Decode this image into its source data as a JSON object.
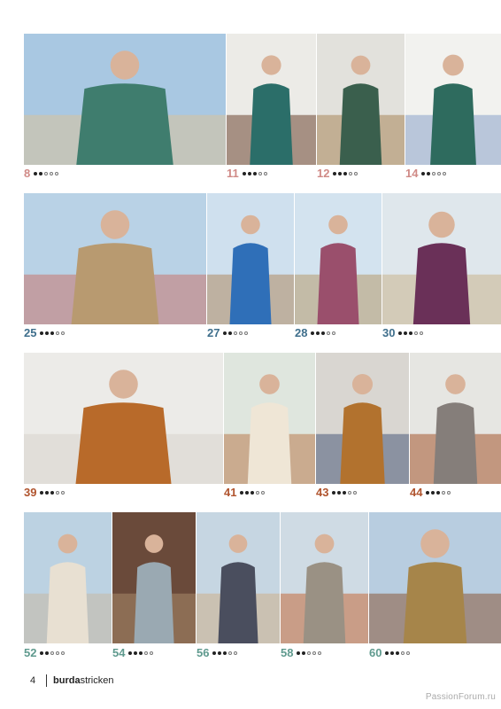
{
  "rows": [
    {
      "color": "#d08a86",
      "items": [
        {
          "id": "p8",
          "number": "8",
          "level": 2,
          "tone": [
            "#a9c8e2",
            "#3f7d6e",
            "#d8c39a"
          ]
        },
        {
          "id": "p11",
          "number": "11",
          "level": 3,
          "tone": [
            "#ecebe7",
            "#2b6e69",
            "#6e4632"
          ]
        },
        {
          "id": "p12",
          "number": "12",
          "level": 3,
          "tone": [
            "#e2e1dc",
            "#3a5f4d",
            "#a8865a"
          ]
        },
        {
          "id": "p14",
          "number": "14",
          "level": 2,
          "tone": [
            "#f2f2ef",
            "#2e6b5e",
            "#8aa2c8"
          ]
        }
      ]
    },
    {
      "color": "#3f6f8c",
      "items": [
        {
          "id": "p25",
          "number": "25",
          "level": 3,
          "tone": [
            "#b9d2e6",
            "#b89a70",
            "#c9756d"
          ]
        },
        {
          "id": "p27",
          "number": "27",
          "level": 2,
          "tone": [
            "#cfe0ee",
            "#2f6fb8",
            "#b08a62"
          ]
        },
        {
          "id": "p28",
          "number": "28",
          "level": 3,
          "tone": [
            "#d3e3ef",
            "#9a4f6c",
            "#b69a6c"
          ]
        },
        {
          "id": "p30",
          "number": "30",
          "level": 3,
          "tone": [
            "#dfe7ec",
            "#6a3058",
            "#c9b48e"
          ]
        }
      ]
    },
    {
      "color": "#b0542e",
      "items": [
        {
          "id": "p39",
          "number": "39",
          "level": 3,
          "tone": [
            "#ecebe8",
            "#b86a2a",
            "#d8d4cc"
          ]
        },
        {
          "id": "p41",
          "number": "41",
          "level": 3,
          "tone": [
            "#dfe6de",
            "#efe6d6",
            "#b87a4e"
          ]
        },
        {
          "id": "p43",
          "number": "43",
          "level": 3,
          "tone": [
            "#d9d6d1",
            "#b2722e",
            "#4a5b7a"
          ]
        },
        {
          "id": "p44",
          "number": "44",
          "level": 3,
          "tone": [
            "#e6e6e2",
            "#857e7a",
            "#a4552e"
          ]
        }
      ]
    },
    {
      "color": "#5f9a8e",
      "items": [
        {
          "id": "p52",
          "number": "52",
          "level": 2,
          "tone": [
            "#bcd2e2",
            "#e8e0d2",
            "#c7b8a4"
          ]
        },
        {
          "id": "p54",
          "number": "54",
          "level": 3,
          "tone": [
            "#6a4a3a",
            "#9aa9b2",
            "#a88a6a"
          ]
        },
        {
          "id": "p56",
          "number": "56",
          "level": 3,
          "tone": [
            "#c6d6e2",
            "#4a4e5e",
            "#cdb08a"
          ]
        },
        {
          "id": "p58",
          "number": "58",
          "level": 2,
          "tone": [
            "#cfdbe4",
            "#9a9184",
            "#c46a3a"
          ]
        },
        {
          "id": "p60",
          "number": "60",
          "level": 3,
          "tone": [
            "#b8cde0",
            "#a6854a",
            "#8a5a3a"
          ]
        }
      ]
    }
  ],
  "footer": {
    "page_number": "4",
    "brand_bold": "burda",
    "brand_regular": "stricken"
  },
  "watermark": "PassionForum.ru"
}
